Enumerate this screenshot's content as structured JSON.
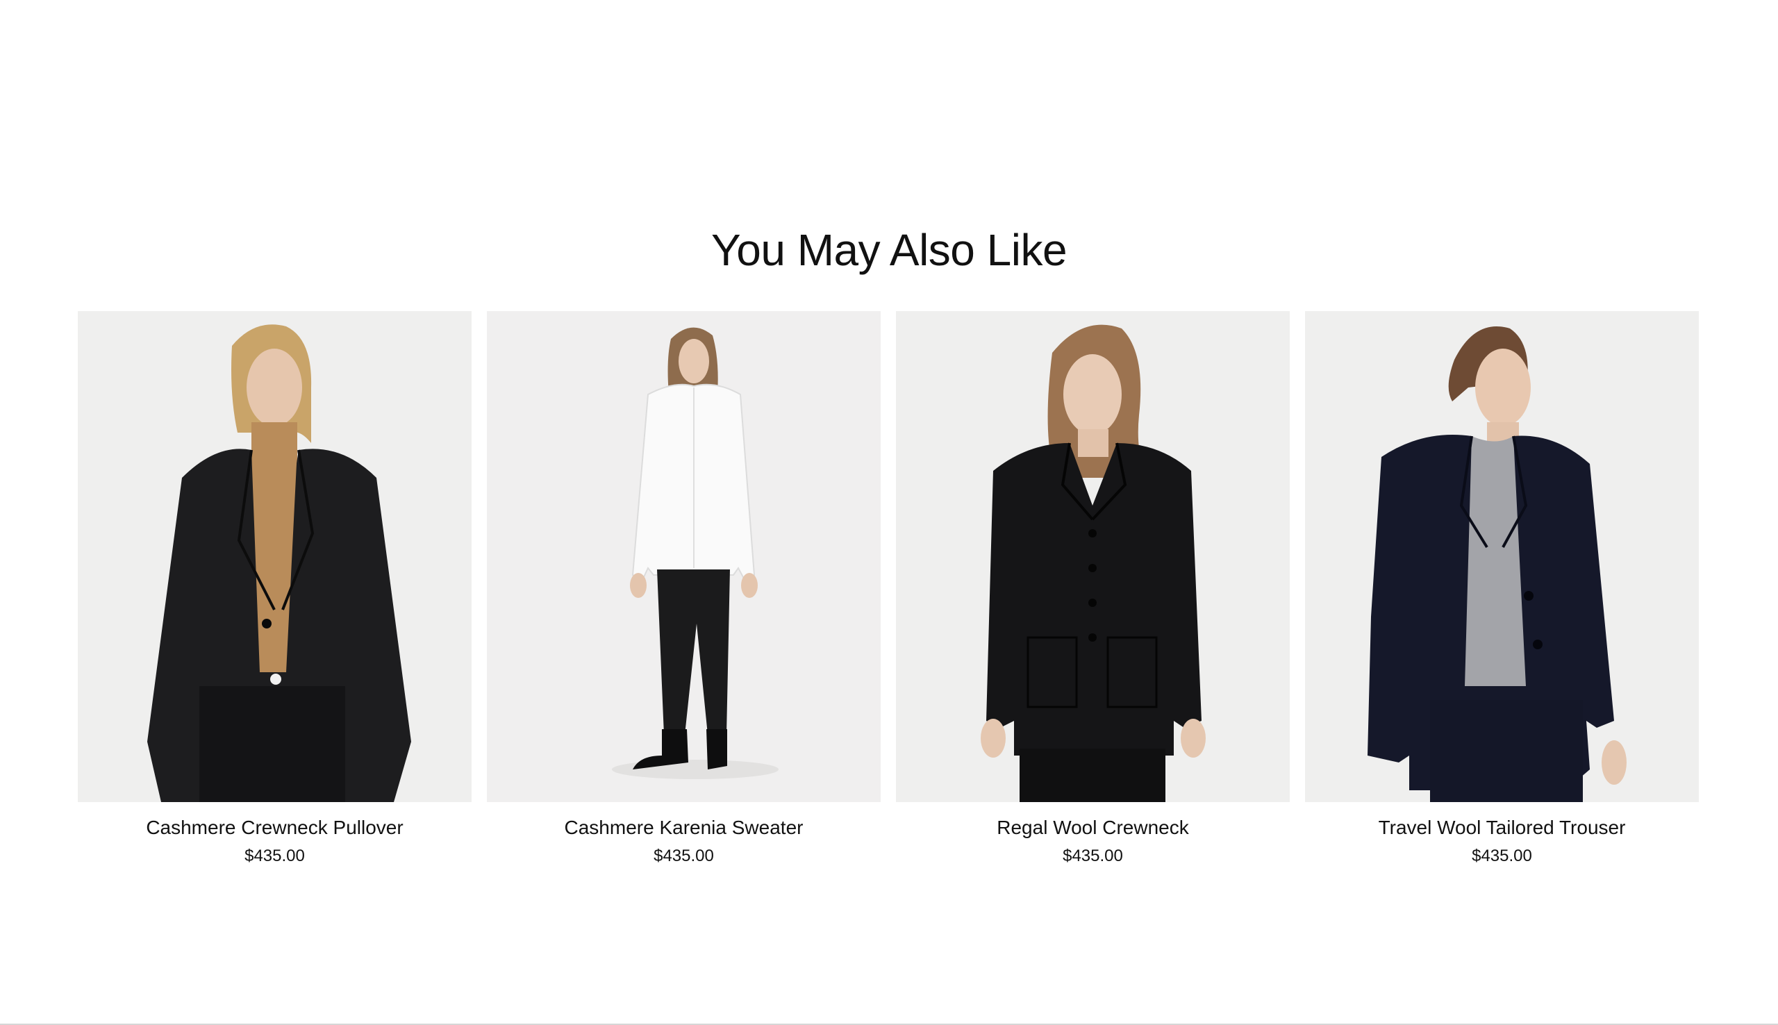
{
  "recommendations": {
    "title": "You May Also Like",
    "products": [
      {
        "name": "Cashmere Crewneck Pullover",
        "price": "$435.00",
        "image_alt": "model-in-black-blazer-camel-turtleneck"
      },
      {
        "name": "Cashmere Karenia Sweater",
        "price": "$435.00",
        "image_alt": "model-in-white-shirt-black-leather-pants"
      },
      {
        "name": "Regal Wool Crewneck",
        "price": "$435.00",
        "image_alt": "model-in-black-buttoned-jacket"
      },
      {
        "name": "Travel Wool Tailored Trouser",
        "price": "$435.00",
        "image_alt": "model-in-navy-suit-grey-sweater"
      }
    ]
  },
  "colors": {
    "background": "#ffffff",
    "photo_background": "#efefee",
    "text": "#111111"
  }
}
